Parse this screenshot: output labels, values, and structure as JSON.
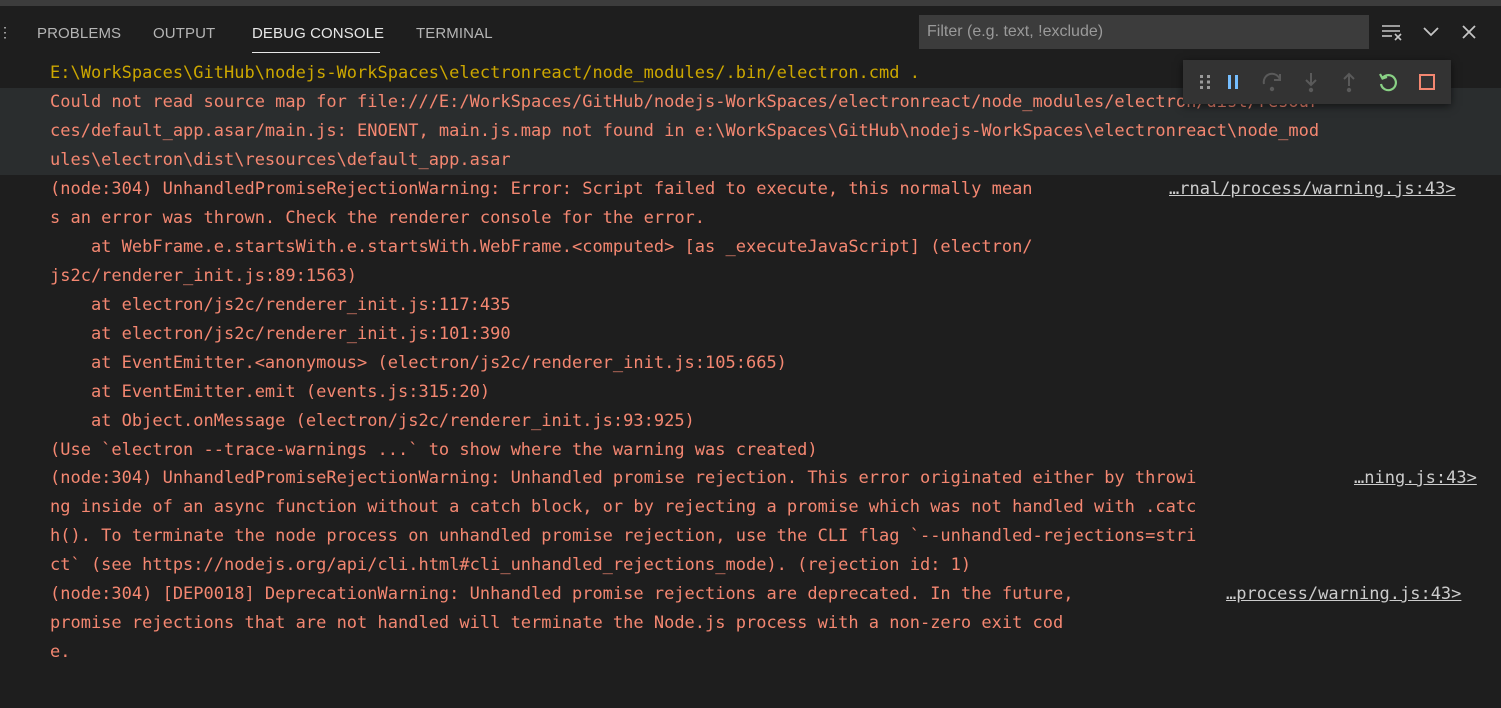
{
  "tabs": [
    {
      "label": "PROBLEMS",
      "active": false
    },
    {
      "label": "OUTPUT",
      "active": false
    },
    {
      "label": "DEBUG CONSOLE",
      "active": true
    },
    {
      "label": "TERMINAL",
      "active": false
    }
  ],
  "filter": {
    "placeholder": "Filter (e.g. text, !exclude)"
  },
  "panel_actions": [
    "clear-console-icon",
    "chevron-down-icon",
    "close-icon"
  ],
  "debug_toolbar": [
    "drag-handle-icon",
    "pause-icon",
    "step-over-icon",
    "step-into-icon",
    "step-out-icon",
    "restart-icon",
    "stop-icon"
  ],
  "colors": {
    "error": "#f48771",
    "command": "#cca700",
    "accent": "#75beff",
    "restart": "#89d185"
  },
  "console": {
    "lines": [
      "E:\\WorkSpaces\\GitHub\\nodejs-WorkSpaces\\electronreact/node_modules/.bin/electron.cmd .",
      "Could not read source map for file:///E:/WorkSpaces/GitHub/nodejs-WorkSpaces/electronreact/node_modules/electron/dist/resour",
      "ces/default_app.asar/main.js: ENOENT, main.js.map not found in e:\\WorkSpaces\\GitHub\\nodejs-WorkSpaces\\electronreact\\node_mod",
      "ules\\electron\\dist\\resources\\default_app.asar",
      "(node:304) UnhandledPromiseRejectionWarning: Error: Script failed to execute, this normally mean",
      "s an error was thrown. Check the renderer console for the error.",
      "    at WebFrame.e.startsWith.e.startsWith.WebFrame.<computed> [as _executeJavaScript] (electron/",
      "js2c/renderer_init.js:89:1563)",
      "    at electron/js2c/renderer_init.js:117:435",
      "    at electron/js2c/renderer_init.js:101:390",
      "    at EventEmitter.<anonymous> (electron/js2c/renderer_init.js:105:665)",
      "    at EventEmitter.emit (events.js:315:20)",
      "    at Object.onMessage (electron/js2c/renderer_init.js:93:925)",
      "(Use `electron --trace-warnings ...` to show where the warning was created)",
      "(node:304) UnhandledPromiseRejectionWarning: Unhandled promise rejection. This error originated either by throwi",
      "ng inside of an async function without a catch block, or by rejecting a promise which was not handled with .catc",
      "h(). To terminate the node process on unhandled promise rejection, use the CLI flag `--unhandled-rejections=stri",
      "ct` (see https://nodejs.org/api/cli.html#cli_unhandled_rejections_mode). (rejection id: 1)",
      "(node:304) [DEP0018] DeprecationWarning: Unhandled promise rejections are deprecated. In the future,",
      "promise rejections that are not handled will terminate the Node.js process with a non-zero exit cod",
      "e."
    ],
    "sources": [
      "…rnal/process/warning.js:43>",
      "…ning.js:43>",
      "…process/warning.js:43>"
    ]
  }
}
